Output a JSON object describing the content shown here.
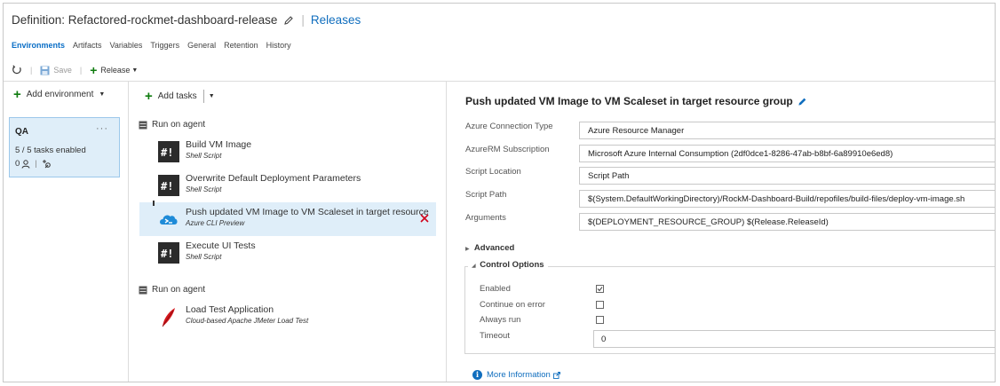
{
  "header": {
    "definition_title": "Definition: Refactored-rockmet-dashboard-release",
    "releases_link": "Releases",
    "tabs": [
      {
        "label": "Environments",
        "active": true
      },
      {
        "label": "Artifacts"
      },
      {
        "label": "Variables"
      },
      {
        "label": "Triggers"
      },
      {
        "label": "General"
      },
      {
        "label": "Retention"
      },
      {
        "label": "History"
      }
    ],
    "toolbar": {
      "save_label": "Save",
      "release_label": "Release"
    }
  },
  "environments": {
    "add_label": "Add environment",
    "items": [
      {
        "name": "QA",
        "status": "5 / 5 tasks enabled",
        "approvers_count": "0",
        "more": "···"
      }
    ]
  },
  "tasks_panel": {
    "add_label": "Add tasks",
    "phases": [
      {
        "label": "Run on agent",
        "tasks": [
          {
            "name": "Build VM Image",
            "type": "Shell Script",
            "icon": "shell-script-icon"
          },
          {
            "name": "Overwrite Default Deployment Parameters",
            "type": "Shell Script",
            "icon": "shell-script-icon"
          },
          {
            "name": "Push updated VM Image to VM Scaleset in target resource",
            "type": "Azure CLI Preview",
            "icon": "azure-cli-icon",
            "selected": true
          },
          {
            "name": "Execute UI Tests",
            "type": "Shell Script",
            "icon": "shell-script-icon"
          }
        ]
      },
      {
        "label": "Run on agent",
        "tasks": [
          {
            "name": "Load Test Application",
            "type": "Cloud-based Apache JMeter Load Test",
            "icon": "jmeter-feather-icon"
          }
        ]
      }
    ]
  },
  "details": {
    "title": "Push updated VM Image to VM Scaleset in target resource group",
    "fields": [
      {
        "label": "Azure Connection Type",
        "value": "Azure Resource Manager"
      },
      {
        "label": "AzureRM Subscription",
        "value": "Microsoft Azure Internal Consumption (2df0dce1-8286-47ab-b8bf-6a89910e6ed8)"
      },
      {
        "label": "Script Location",
        "value": "Script Path"
      },
      {
        "label": "Script Path",
        "value": "$(System.DefaultWorkingDirectory)/RockM-Dashboard-Build/repofiles/build-files/deploy-vm-image.sh"
      },
      {
        "label": "Arguments",
        "value": "$(DEPLOYMENT_RESOURCE_GROUP) $(Release.ReleaseId)"
      }
    ],
    "advanced_label": "Advanced",
    "control_options": {
      "label": "Control Options",
      "enabled_label": "Enabled",
      "enabled": true,
      "continue_label": "Continue on error",
      "continue_on_error": false,
      "always_run_label": "Always run",
      "always_run": false,
      "timeout_label": "Timeout",
      "timeout_value": "0"
    },
    "more_info_label": "More Information"
  },
  "colors": {
    "accent": "#106ebe",
    "selected_bg": "#dfeef9",
    "add_green": "#107c10",
    "remove_red": "#d0021b"
  }
}
